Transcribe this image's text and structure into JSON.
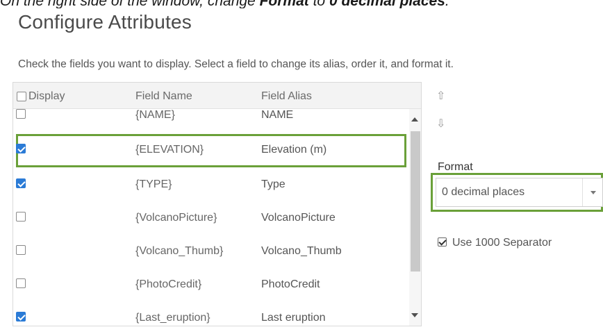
{
  "instruction": {
    "prefix": "On the right side of the window, change ",
    "field": "Format",
    "middle": " to ",
    "value": "0 decimal places",
    "suffix": "."
  },
  "dialog": {
    "title": "Configure Attributes",
    "description": "Check the fields you want to display. Select a field to change its alias, order it, and format it."
  },
  "table": {
    "headers": {
      "display": "Display",
      "field_name": "Field Name",
      "field_alias": "Field Alias"
    },
    "rows": [
      {
        "checked": false,
        "field_name": "{NAME}",
        "field_alias": "NAME"
      },
      {
        "checked": true,
        "field_name": "{ELEVATION}",
        "field_alias": "Elevation (m)",
        "selected": true
      },
      {
        "checked": true,
        "field_name": "{TYPE}",
        "field_alias": "Type"
      },
      {
        "checked": false,
        "field_name": "{VolcanoPicture}",
        "field_alias": "VolcanoPicture"
      },
      {
        "checked": false,
        "field_name": "{Volcano_Thumb}",
        "field_alias": "Volcano_Thumb"
      },
      {
        "checked": false,
        "field_name": "{PhotoCredit}",
        "field_alias": "PhotoCredit"
      },
      {
        "checked": true,
        "field_name": "{Last_eruption}",
        "field_alias": "Last eruption"
      }
    ]
  },
  "ordering": {
    "up_icon": "⇧",
    "down_icon": "⇩"
  },
  "format": {
    "label": "Format",
    "selected": "0 decimal places",
    "use_separator_label": "Use 1000 Separator",
    "use_separator_checked": true
  },
  "colors": {
    "highlight": "#6aa039",
    "checkbox_checked": "#2b7bd6"
  }
}
